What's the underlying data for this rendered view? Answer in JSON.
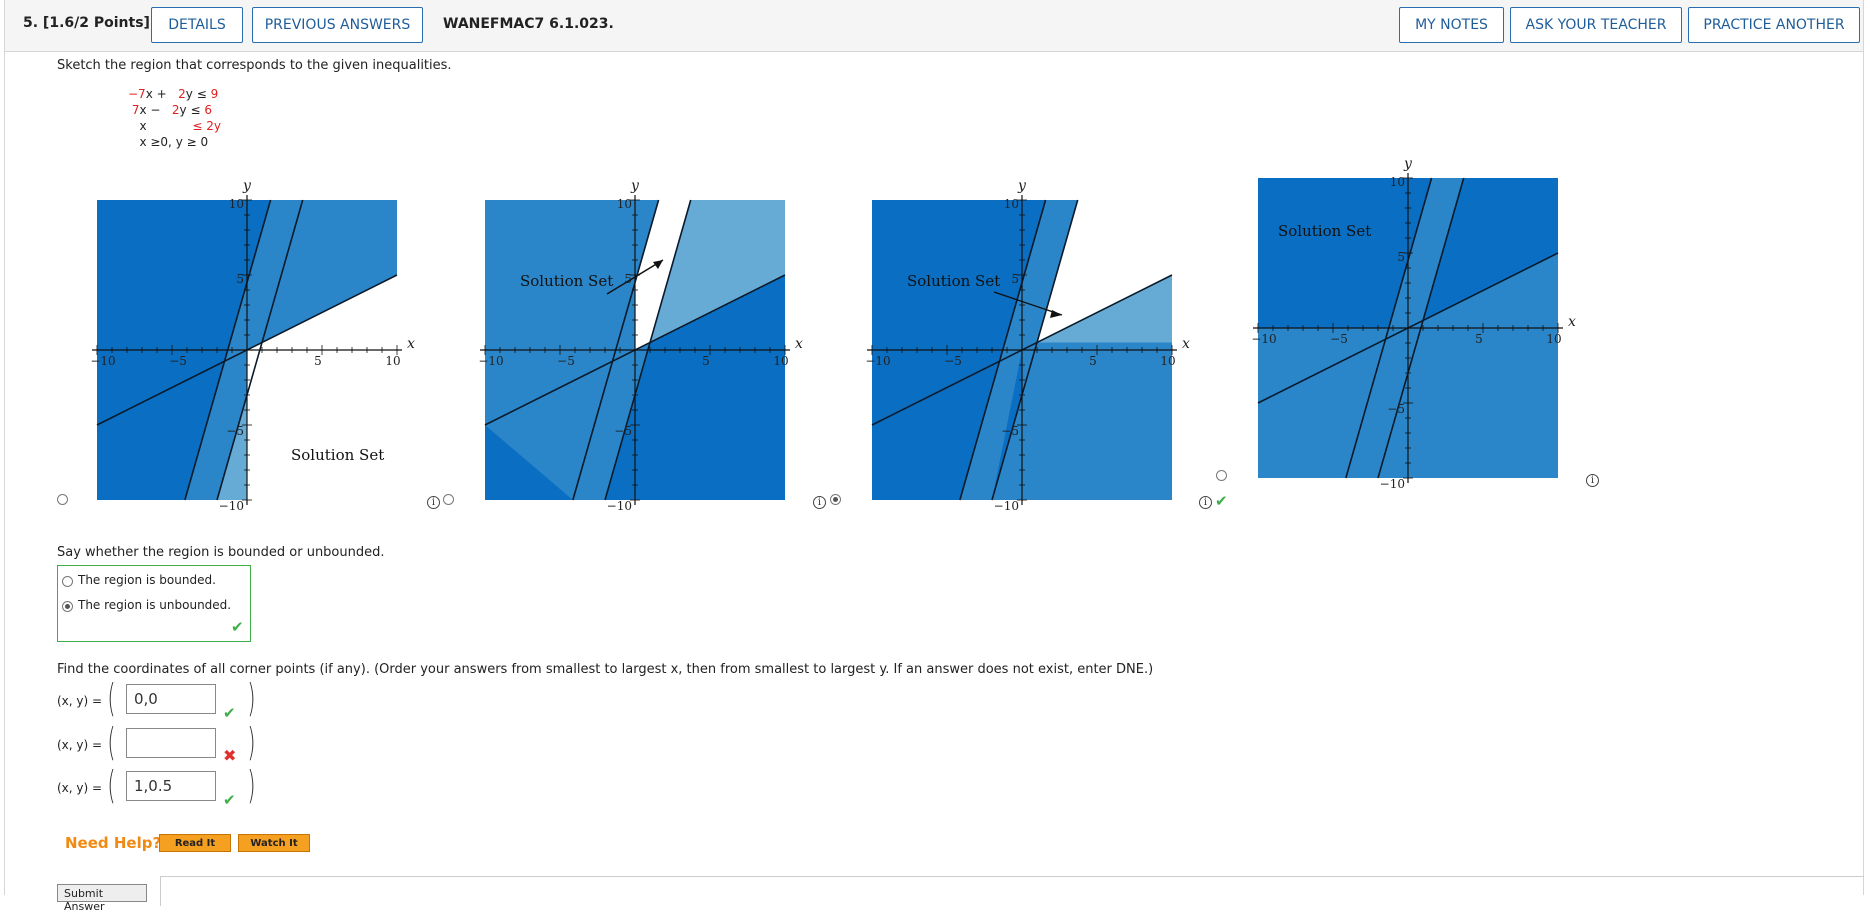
{
  "header": {
    "question": "5. [1.6/2 Points]",
    "details": "DETAILS",
    "previous_answers": "PREVIOUS ANSWERS",
    "code": "WANEFMAC7 6.1.023.",
    "my_notes": "MY NOTES",
    "ask_teacher": "ASK YOUR TEACHER",
    "practice_another": "PRACTICE ANOTHER"
  },
  "prompt": "Sketch the region that corresponds to the given inequalities.",
  "inequalities": [
    {
      "lhs_a": "−7",
      "lhs_rest": "x +",
      "coef": "2",
      "var": "y ≤",
      "rhs": "9"
    },
    {
      "lhs_a": "7",
      "lhs_rest": "x −",
      "coef": "2",
      "var": "y ≤",
      "rhs": "6"
    },
    {
      "lhs_a": "",
      "lhs_rest": "x",
      "coef": "",
      "var": "≤ 2y",
      "rhs": ""
    },
    {
      "lhs_a": "",
      "lhs_rest": "x ≥0, y ≥ 0",
      "coef": "",
      "var": "",
      "rhs": ""
    }
  ],
  "graphs": {
    "solution_label": "Solution Set",
    "x_label": "x",
    "y_label": "y",
    "ticks": [
      "−10",
      "−5",
      "5",
      "10"
    ],
    "ytick_10": "10",
    "ytick_5": "5",
    "ytick_m5": "−5",
    "ytick_m10": "−10",
    "selected_option": 2,
    "info_symbol": "i"
  },
  "bounded_question": "Say whether the region is bounded or unbounded.",
  "bounded_options": [
    "The region is bounded.",
    "The region is unbounded."
  ],
  "corner_question": "Find the coordinates of all corner points (if any). (Order your answers from smallest to largest x, then from smallest to largest y. If an answer does not exist, enter DNE.)",
  "corner_label": "(x, y) =",
  "corners": [
    {
      "value": "0,0",
      "status": "correct"
    },
    {
      "value": "",
      "status": "incorrect"
    },
    {
      "value": "1,0.5",
      "status": "correct"
    }
  ],
  "help": {
    "label": "Need Help?",
    "read": "Read It",
    "watch": "Watch It"
  },
  "submit": "Submit Answer",
  "colors": {
    "dark": "#0a6fc2",
    "mid": "#2a86c8",
    "light": "#66aad6",
    "accent": "#1f5d99",
    "green": "#3fae49",
    "red": "#e03030"
  }
}
